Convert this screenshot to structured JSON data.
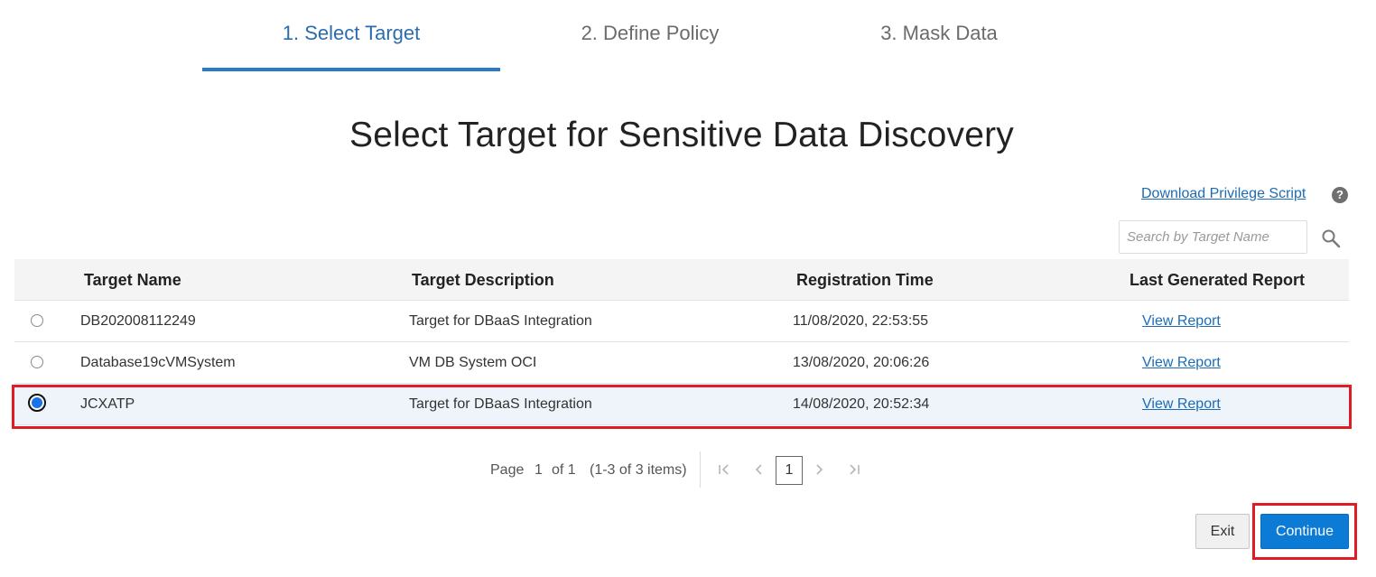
{
  "wizard": {
    "steps": [
      {
        "label": "1. Select Target",
        "active": true
      },
      {
        "label": "2. Define Policy",
        "active": false
      },
      {
        "label": "3. Mask Data",
        "active": false
      }
    ]
  },
  "page_title": "Select Target for Sensitive Data Discovery",
  "download_link": "Download Privilege Script",
  "help_icon": "?",
  "search": {
    "placeholder": "Search by Target Name",
    "value": ""
  },
  "table": {
    "columns": [
      "Target Name",
      "Target Description",
      "Registration Time",
      "Last Generated Report"
    ],
    "rows": [
      {
        "name": "DB202008112249",
        "description": "Target for DBaaS Integration",
        "time": "11/08/2020, 22:53:55",
        "report": "View Report",
        "selected": false
      },
      {
        "name": "Database19cVMSystem",
        "description": "VM DB System OCI",
        "time": "13/08/2020, 20:06:26",
        "report": "View Report",
        "selected": false
      },
      {
        "name": "JCXATP",
        "description": "Target for DBaaS Integration",
        "time": "14/08/2020, 20:52:34",
        "report": "View Report",
        "selected": true
      }
    ]
  },
  "pagination": {
    "page_label": "Page",
    "current_page": "1",
    "of_label": "of 1",
    "items_label": "(1-3 of 3 items)",
    "page_button": "1",
    "first_icon": "first-page-icon",
    "prev_icon": "previous-page-icon",
    "next_icon": "next-page-icon",
    "last_icon": "last-page-icon"
  },
  "buttons": {
    "exit": "Exit",
    "continue": "Continue"
  },
  "colors": {
    "accent": "#2a7bc4",
    "link": "#1b6cb5",
    "primary_button": "#0b7bd6",
    "highlight": "#e01b24",
    "selected_row": "#eef4fa"
  }
}
